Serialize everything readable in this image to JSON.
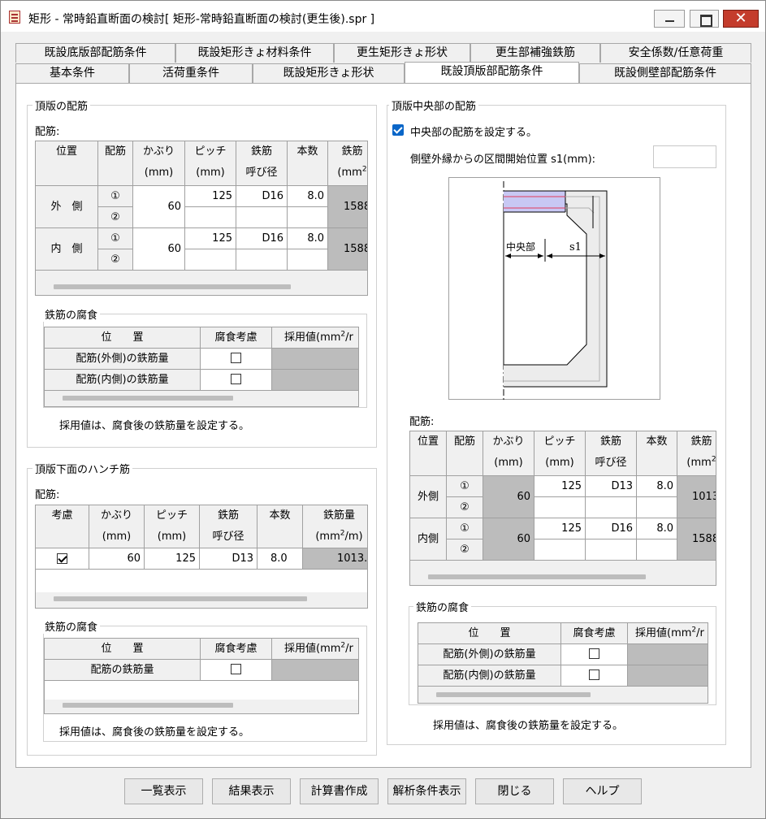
{
  "window": {
    "title": "矩形 - 常時鉛直断面の検討[ 矩形-常時鉛直断面の検討(更生後).spr ]",
    "close_glyph": "✕"
  },
  "tabs_row1": [
    {
      "label": "既設底版部配筋条件"
    },
    {
      "label": "既設矩形きょ材料条件"
    },
    {
      "label": "更生矩形きょ形状"
    },
    {
      "label": "更生部補強鉄筋"
    },
    {
      "label": "安全係数/任意荷重"
    }
  ],
  "tabs_row2": [
    {
      "label": "基本条件"
    },
    {
      "label": "活荷重条件"
    },
    {
      "label": "既設矩形きょ形状"
    },
    {
      "label": "既設頂版部配筋条件"
    },
    {
      "label": "既設側壁部配筋条件"
    }
  ],
  "active_tab": "既設頂版部配筋条件",
  "left": {
    "top_group": {
      "title": "頂版の配筋",
      "rebar_label": "配筋:",
      "headers": {
        "position": "位置",
        "rebar": "配筋",
        "cover": "かぶり",
        "cover_unit": "(mm)",
        "pitch": "ピッチ",
        "pitch_unit": "(mm)",
        "bar": "鉄筋",
        "bar_sub": "呼び径",
        "count": "本数",
        "area": "鉄筋",
        "area_unit": "(mm",
        "area_sup": "2"
      },
      "rows": [
        {
          "position": "外　側",
          "num1": "①",
          "num2": "②",
          "cover": "60",
          "pitch": "125",
          "diameter": "D16",
          "count": "8.0",
          "area": "1588"
        },
        {
          "position": "内　側",
          "num1": "①",
          "num2": "②",
          "cover": "60",
          "pitch": "125",
          "diameter": "D16",
          "count": "8.0",
          "area": "1588"
        }
      ],
      "corrosion": {
        "title": "鉄筋の腐食",
        "headers": {
          "position": "位　　置",
          "consider": "腐食考慮",
          "adopted": "採用値(mm",
          "adopted_sup": "2",
          "adopted_end": "/r"
        },
        "rows": [
          {
            "label": "配筋(外側)の鉄筋量",
            "checked": false
          },
          {
            "label": "配筋(内側)の鉄筋量",
            "checked": false
          }
        ],
        "note": "採用値は、腐食後の鉄筋量を設定する。"
      }
    },
    "haunch_group": {
      "title": "頂版下面のハンチ筋",
      "rebar_label": "配筋:",
      "headers": {
        "consider": "考慮",
        "cover": "かぶり",
        "cover_unit": "(mm)",
        "pitch": "ピッチ",
        "pitch_unit": "(mm)",
        "bar": "鉄筋",
        "bar_sub": "呼び径",
        "count": "本数",
        "area": "鉄筋量",
        "area_unit": "(mm",
        "area_sup": "2",
        "area_end": "/m)"
      },
      "row": {
        "checked": true,
        "cover": "60",
        "pitch": "125",
        "diameter": "D13",
        "count": "8.0",
        "area": "1013."
      },
      "corrosion": {
        "title": "鉄筋の腐食",
        "headers": {
          "position": "位　　置",
          "consider": "腐食考慮",
          "adopted": "採用値(mm",
          "adopted_sup": "2",
          "adopted_end": "/r"
        },
        "rows": [
          {
            "label": "配筋の鉄筋量",
            "checked": false
          }
        ],
        "note": "採用値は、腐食後の鉄筋量を設定する。"
      }
    }
  },
  "right": {
    "group": {
      "title": "頂版中央部の配筋",
      "checkbox_label": "中央部の配筋を設定する。",
      "checkbox_checked": true,
      "s1_label": "側壁外縁からの区間開始位置 s1(mm):",
      "s1_value": "",
      "diagram": {
        "center_label": "中央部",
        "s1_label": "s1"
      },
      "rebar_label": "配筋:",
      "headers": {
        "position": "位置",
        "rebar": "配筋",
        "cover": "かぶり",
        "cover_unit": "(mm)",
        "pitch": "ピッチ",
        "pitch_unit": "(mm)",
        "bar": "鉄筋",
        "bar_sub": "呼び径",
        "count": "本数",
        "area": "鉄筋",
        "area_unit": "(mm",
        "area_sup": "2"
      },
      "rows": [
        {
          "position": "外側",
          "num1": "①",
          "num2": "②",
          "cover": "60",
          "pitch": "125",
          "diameter": "D13",
          "count": "8.0",
          "area": "1013"
        },
        {
          "position": "内側",
          "num1": "①",
          "num2": "②",
          "cover": "60",
          "pitch": "125",
          "diameter": "D16",
          "count": "8.0",
          "area": "1588"
        }
      ],
      "corrosion": {
        "title": "鉄筋の腐食",
        "headers": {
          "position": "位　　置",
          "consider": "腐食考慮",
          "adopted": "採用値(mm",
          "adopted_sup": "2",
          "adopted_end": "/r"
        },
        "rows": [
          {
            "label": "配筋(外側)の鉄筋量",
            "checked": false
          },
          {
            "label": "配筋(内側)の鉄筋量",
            "checked": false
          }
        ],
        "note": "採用値は、腐食後の鉄筋量を設定する。"
      }
    }
  },
  "buttons": [
    {
      "label": "一覧表示"
    },
    {
      "label": "結果表示"
    },
    {
      "label": "計算書作成"
    },
    {
      "label": "解析条件表示"
    },
    {
      "label": "閉じる"
    },
    {
      "label": "ヘルプ"
    }
  ],
  "colors": {
    "accent_blue": "#0a66c8",
    "close_red": "#c43c2c",
    "readonly_gray": "#bcbcbc",
    "diagram_band_fill": "#c8c8f4",
    "diagram_rebar_red": "#e23c5c"
  }
}
